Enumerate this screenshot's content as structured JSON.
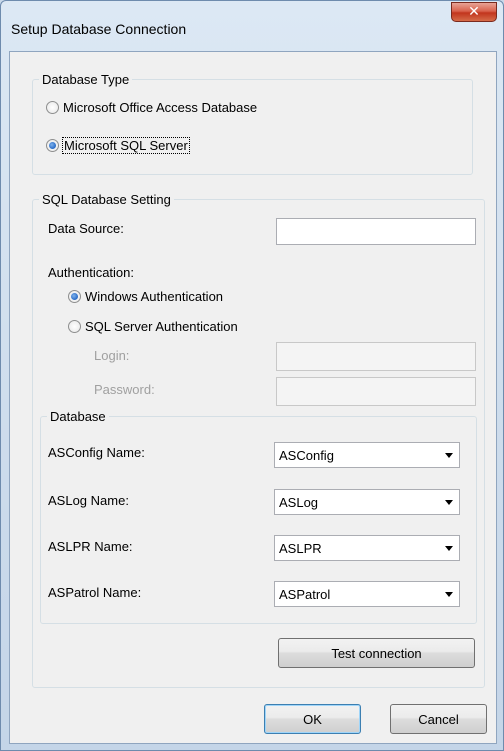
{
  "window": {
    "title": "Setup Database Connection",
    "close_glyph": "✕"
  },
  "database_type": {
    "legend": "Database Type",
    "options": [
      {
        "label": "Microsoft Office Access Database",
        "checked": false
      },
      {
        "label": "Microsoft SQL Server",
        "checked": true
      }
    ]
  },
  "sql_setting": {
    "legend": "SQL Database Setting",
    "data_source_label": "Data Source:",
    "data_source_value": "",
    "authentication_label": "Authentication:",
    "auth_options": [
      {
        "label": "Windows Authentication",
        "checked": true
      },
      {
        "label": "SQL Server Authentication",
        "checked": false
      }
    ],
    "login_label": "Login:",
    "login_value": "",
    "password_label": "Password:",
    "password_value": ""
  },
  "database": {
    "legend": "Database",
    "rows": [
      {
        "label": "ASConfig Name:",
        "value": "ASConfig"
      },
      {
        "label": "ASLog Name:",
        "value": "ASLog"
      },
      {
        "label": "ASLPR Name:",
        "value": "ASLPR"
      },
      {
        "label": "ASPatrol Name:",
        "value": "ASPatrol"
      }
    ]
  },
  "buttons": {
    "test_connection": "Test connection",
    "ok": "OK",
    "cancel": "Cancel"
  }
}
